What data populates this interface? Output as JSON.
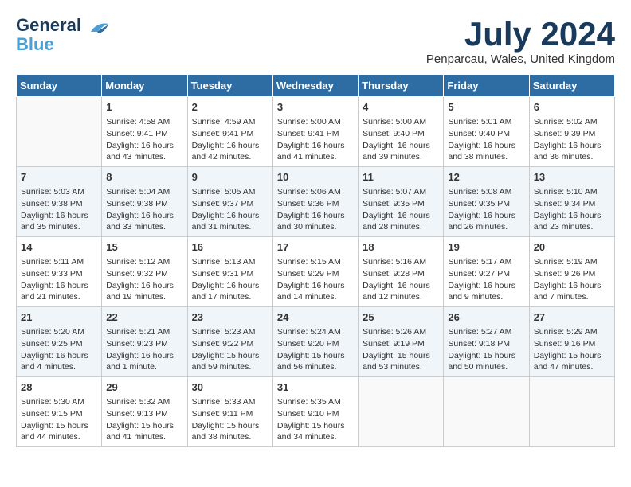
{
  "header": {
    "logo_line1": "General",
    "logo_line2": "Blue",
    "month_year": "July 2024",
    "location": "Penparcau, Wales, United Kingdom"
  },
  "weekdays": [
    "Sunday",
    "Monday",
    "Tuesday",
    "Wednesday",
    "Thursday",
    "Friday",
    "Saturday"
  ],
  "weeks": [
    [
      {
        "day": "",
        "data": ""
      },
      {
        "day": "1",
        "data": "Sunrise: 4:58 AM\nSunset: 9:41 PM\nDaylight: 16 hours\nand 43 minutes."
      },
      {
        "day": "2",
        "data": "Sunrise: 4:59 AM\nSunset: 9:41 PM\nDaylight: 16 hours\nand 42 minutes."
      },
      {
        "day": "3",
        "data": "Sunrise: 5:00 AM\nSunset: 9:41 PM\nDaylight: 16 hours\nand 41 minutes."
      },
      {
        "day": "4",
        "data": "Sunrise: 5:00 AM\nSunset: 9:40 PM\nDaylight: 16 hours\nand 39 minutes."
      },
      {
        "day": "5",
        "data": "Sunrise: 5:01 AM\nSunset: 9:40 PM\nDaylight: 16 hours\nand 38 minutes."
      },
      {
        "day": "6",
        "data": "Sunrise: 5:02 AM\nSunset: 9:39 PM\nDaylight: 16 hours\nand 36 minutes."
      }
    ],
    [
      {
        "day": "7",
        "data": "Sunrise: 5:03 AM\nSunset: 9:38 PM\nDaylight: 16 hours\nand 35 minutes."
      },
      {
        "day": "8",
        "data": "Sunrise: 5:04 AM\nSunset: 9:38 PM\nDaylight: 16 hours\nand 33 minutes."
      },
      {
        "day": "9",
        "data": "Sunrise: 5:05 AM\nSunset: 9:37 PM\nDaylight: 16 hours\nand 31 minutes."
      },
      {
        "day": "10",
        "data": "Sunrise: 5:06 AM\nSunset: 9:36 PM\nDaylight: 16 hours\nand 30 minutes."
      },
      {
        "day": "11",
        "data": "Sunrise: 5:07 AM\nSunset: 9:35 PM\nDaylight: 16 hours\nand 28 minutes."
      },
      {
        "day": "12",
        "data": "Sunrise: 5:08 AM\nSunset: 9:35 PM\nDaylight: 16 hours\nand 26 minutes."
      },
      {
        "day": "13",
        "data": "Sunrise: 5:10 AM\nSunset: 9:34 PM\nDaylight: 16 hours\nand 23 minutes."
      }
    ],
    [
      {
        "day": "14",
        "data": "Sunrise: 5:11 AM\nSunset: 9:33 PM\nDaylight: 16 hours\nand 21 minutes."
      },
      {
        "day": "15",
        "data": "Sunrise: 5:12 AM\nSunset: 9:32 PM\nDaylight: 16 hours\nand 19 minutes."
      },
      {
        "day": "16",
        "data": "Sunrise: 5:13 AM\nSunset: 9:31 PM\nDaylight: 16 hours\nand 17 minutes."
      },
      {
        "day": "17",
        "data": "Sunrise: 5:15 AM\nSunset: 9:29 PM\nDaylight: 16 hours\nand 14 minutes."
      },
      {
        "day": "18",
        "data": "Sunrise: 5:16 AM\nSunset: 9:28 PM\nDaylight: 16 hours\nand 12 minutes."
      },
      {
        "day": "19",
        "data": "Sunrise: 5:17 AM\nSunset: 9:27 PM\nDaylight: 16 hours\nand 9 minutes."
      },
      {
        "day": "20",
        "data": "Sunrise: 5:19 AM\nSunset: 9:26 PM\nDaylight: 16 hours\nand 7 minutes."
      }
    ],
    [
      {
        "day": "21",
        "data": "Sunrise: 5:20 AM\nSunset: 9:25 PM\nDaylight: 16 hours\nand 4 minutes."
      },
      {
        "day": "22",
        "data": "Sunrise: 5:21 AM\nSunset: 9:23 PM\nDaylight: 16 hours\nand 1 minute."
      },
      {
        "day": "23",
        "data": "Sunrise: 5:23 AM\nSunset: 9:22 PM\nDaylight: 15 hours\nand 59 minutes."
      },
      {
        "day": "24",
        "data": "Sunrise: 5:24 AM\nSunset: 9:20 PM\nDaylight: 15 hours\nand 56 minutes."
      },
      {
        "day": "25",
        "data": "Sunrise: 5:26 AM\nSunset: 9:19 PM\nDaylight: 15 hours\nand 53 minutes."
      },
      {
        "day": "26",
        "data": "Sunrise: 5:27 AM\nSunset: 9:18 PM\nDaylight: 15 hours\nand 50 minutes."
      },
      {
        "day": "27",
        "data": "Sunrise: 5:29 AM\nSunset: 9:16 PM\nDaylight: 15 hours\nand 47 minutes."
      }
    ],
    [
      {
        "day": "28",
        "data": "Sunrise: 5:30 AM\nSunset: 9:15 PM\nDaylight: 15 hours\nand 44 minutes."
      },
      {
        "day": "29",
        "data": "Sunrise: 5:32 AM\nSunset: 9:13 PM\nDaylight: 15 hours\nand 41 minutes."
      },
      {
        "day": "30",
        "data": "Sunrise: 5:33 AM\nSunset: 9:11 PM\nDaylight: 15 hours\nand 38 minutes."
      },
      {
        "day": "31",
        "data": "Sunrise: 5:35 AM\nSunset: 9:10 PM\nDaylight: 15 hours\nand 34 minutes."
      },
      {
        "day": "",
        "data": ""
      },
      {
        "day": "",
        "data": ""
      },
      {
        "day": "",
        "data": ""
      }
    ]
  ]
}
